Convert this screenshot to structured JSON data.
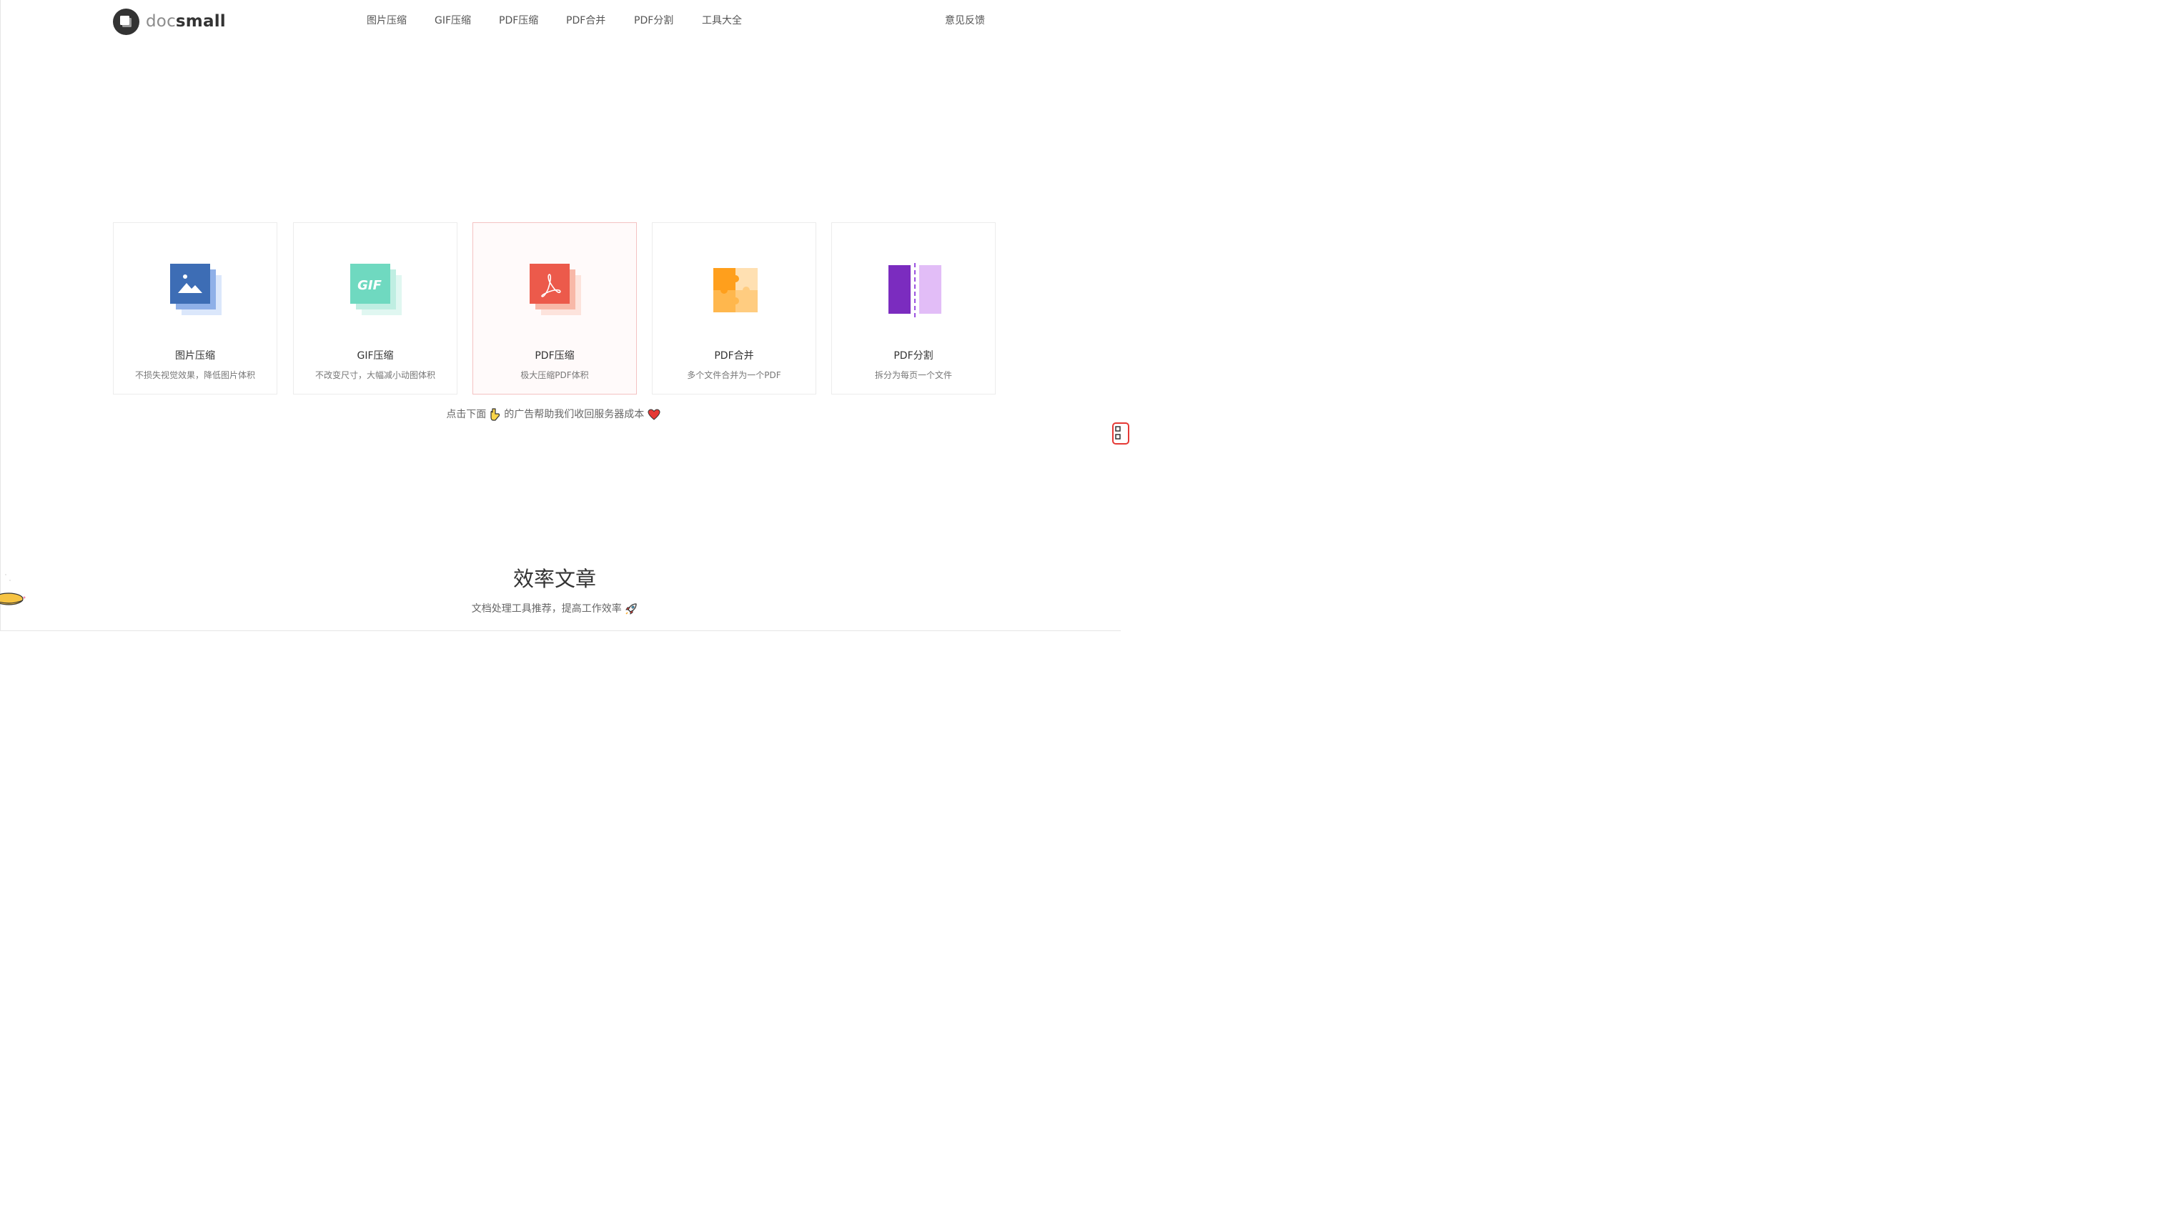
{
  "logo": {
    "text_doc": "doc",
    "text_small": "small"
  },
  "nav": {
    "items": [
      {
        "label": "图片压缩"
      },
      {
        "label": "GIF压缩"
      },
      {
        "label": "PDF压缩"
      },
      {
        "label": "PDF合并"
      },
      {
        "label": "PDF分割"
      },
      {
        "label": "工具大全"
      }
    ],
    "feedback": "意见反馈"
  },
  "cards": [
    {
      "title": "图片压缩",
      "desc": "不损失视觉效果，降低图片体积",
      "icon": "image-compress-icon",
      "color": "#3d6db5"
    },
    {
      "title": "GIF压缩",
      "desc": "不改变尺寸，大幅减小动图体积",
      "icon": "gif-compress-icon",
      "color": "#6fd9c0",
      "icon_text": "GIF"
    },
    {
      "title": "PDF压缩",
      "desc": "极大压缩PDF体积",
      "icon": "pdf-compress-icon",
      "color": "#ec5a4b"
    },
    {
      "title": "PDF合并",
      "desc": "多个文件合并为一个PDF",
      "icon": "pdf-merge-icon",
      "color": "#ff9f1c"
    },
    {
      "title": "PDF分割",
      "desc": "拆分为每页一个文件",
      "icon": "pdf-split-icon",
      "color": "#7b2cbf"
    }
  ],
  "ad_note": {
    "before": "点击下面",
    "after": "的广告帮助我们收回服务器成本"
  },
  "articles": {
    "title": "效率文章",
    "subtitle": "文档处理工具推荐，提高工作效率"
  }
}
